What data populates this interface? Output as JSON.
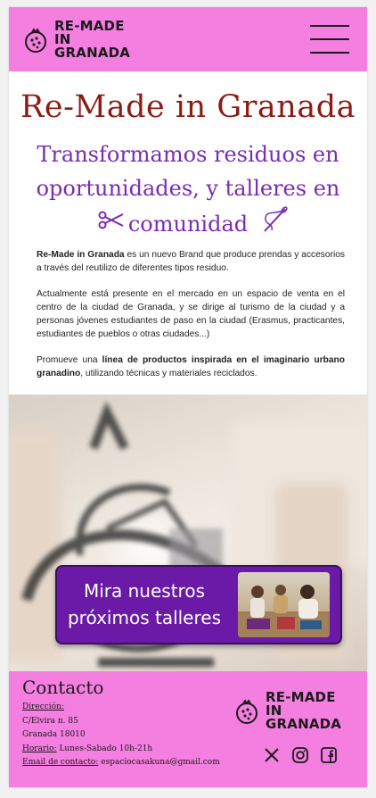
{
  "header": {
    "logo_line1": "RE-MADE",
    "logo_line2": "IN",
    "logo_line3": "GRANADA",
    "menu_icon": "hamburger-menu-icon"
  },
  "hero": {
    "title": "Re-Made in Granada",
    "subtitle_line1": "Transformamos residuos en",
    "subtitle_line2": "oportunidades, y talleres en",
    "subtitle_line3": "comunidad",
    "left_icon": "scissors-icon",
    "right_icon": "needle-thread-icon"
  },
  "intro": {
    "p1_bold": "Re-Made in Granada",
    "p1_rest": " es un nuevo Brand que produce prendas y accesorios a través del reutilizo de diferentes tipos residuo.",
    "p2": "Actualmente está presente en el mercado en un espacio de venta en el  centro de la ciudad de Granada, y se dirige al turismo de la ciudad y a  personas jóvenes estudiantes de paso en la ciudad (Erasmus, practicantes, estudiantes de pueblos o otras ciudades...)",
    "p3_a": "Promueve una ",
    "p3_bold": "línea de productos inspirada en el imaginario urbano granadino",
    "p3_c": ", utilizando técnicas y materiales reciclados."
  },
  "cta": {
    "line1": "Mira nuestros",
    "line2": "próximos talleres"
  },
  "footer": {
    "contact_title": "Contacto",
    "address_label": "Dirección:",
    "address_line1": "C/Elvira n. 85",
    "address_line2": "Granada 18010",
    "hours_label": "Horario:",
    "hours_value": " Lunes-Sabado 10h-21h",
    "email_label": "Email de contacto:",
    "email_value": " espaciocasakuna@gmail.com",
    "logo_line1": "RE-MADE",
    "logo_line2": "IN",
    "logo_line3": "GRANADA",
    "social_icons": [
      "x-icon",
      "instagram-icon",
      "facebook-icon"
    ]
  },
  "colors": {
    "header_pink": "#f47fe0",
    "title_red": "#8b1c14",
    "subtitle_purple": "#7a2bb4",
    "cta_purple": "#6a1aa6"
  }
}
